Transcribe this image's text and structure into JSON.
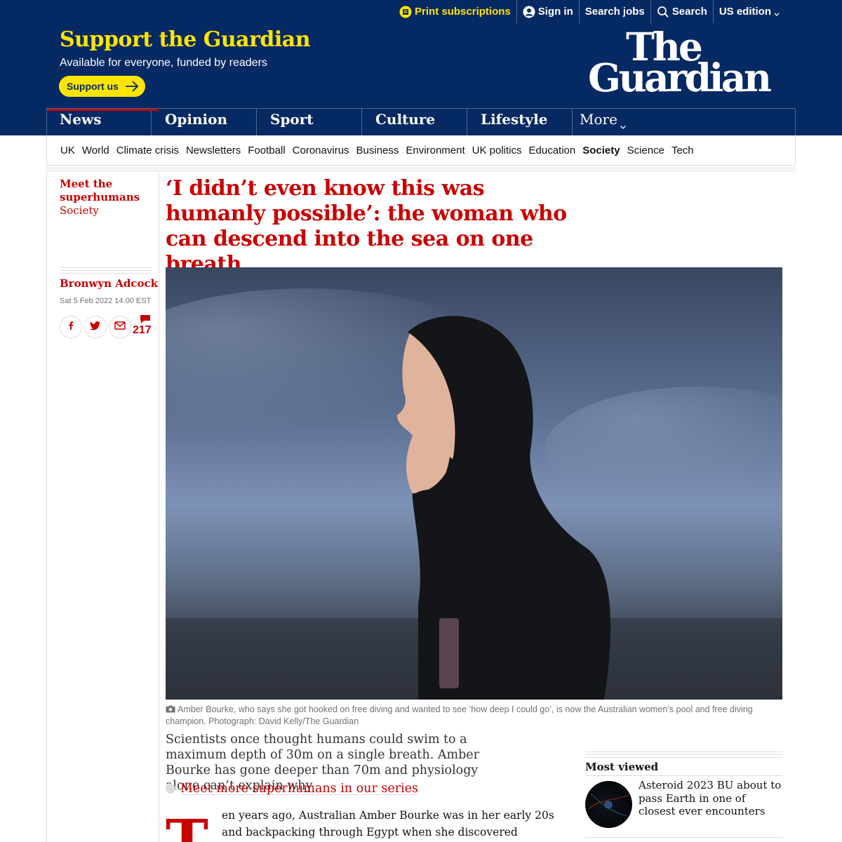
{
  "topbar": {
    "print_subscriptions": "Print subscriptions",
    "sign_in": "Sign in",
    "search_jobs": "Search jobs",
    "search": "Search",
    "edition": "US edition"
  },
  "header": {
    "support_title": "Support the Guardian",
    "support_subtitle": "Available for everyone, funded by readers",
    "support_button": "Support us",
    "logo_line1": "The",
    "logo_line2": "Guardian"
  },
  "pillars": [
    "News",
    "Opinion",
    "Sport",
    "Culture",
    "Lifestyle"
  ],
  "pillar_more": "More",
  "subnav": [
    "UK",
    "World",
    "Climate crisis",
    "Newsletters",
    "Football",
    "Coronavirus",
    "Business",
    "Environment",
    "UK politics",
    "Education",
    "Society",
    "Science",
    "Tech"
  ],
  "subnav_active": "Society",
  "article": {
    "series": "Meet the superhumans",
    "section": "Society",
    "author": "Bronwyn Adcock",
    "date": "Sat 5 Feb 2022 14.00 EST",
    "comment_count": "217",
    "headline": "‘I didn’t even know this was humanly possible’: the woman who can descend into the sea on one breath",
    "caption": "Amber Bourke, who says she got hooked on free diving and wanted to see ‘how deep I could go’, is now the Australian women’s pool and free diving champion. Photograph: David Kelly/The Guardian",
    "standfirst": "Scientists once thought humans could swim to a maximum depth of 30m on a single breath. Amber Bourke has gone deeper than 70m and physiology alone can’t explain why",
    "series_link": "Meet more superhumans in our series",
    "dropcap": "T",
    "body_text": "en years ago, Australian Amber Bourke was in her early 20s and backpacking through Egypt when she discovered something"
  },
  "most_viewed": {
    "title": "Most viewed",
    "headline": "Asteroid 2023 BU about to pass Earth in one of closest ever encounters"
  },
  "colors": {
    "brand_blue": "#052962",
    "support_yellow": "#ffe500",
    "news_red": "#c70000"
  }
}
